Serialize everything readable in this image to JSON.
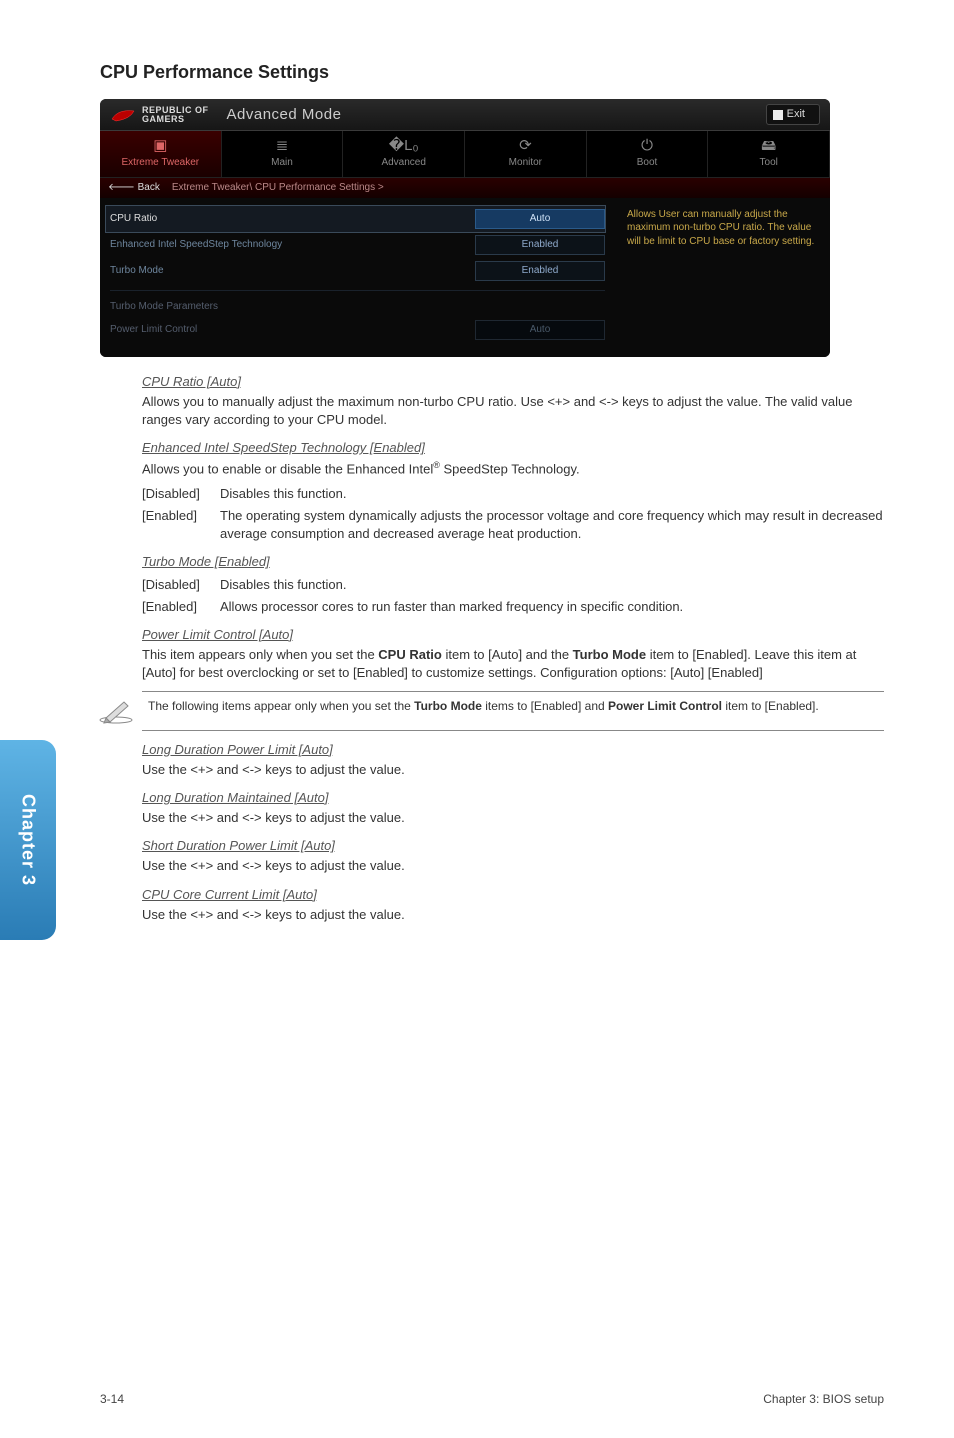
{
  "page": {
    "title": "CPU Performance Settings",
    "side_tab": "Chapter 3",
    "footer_left": "3-14",
    "footer_right": "Chapter 3: BIOS setup"
  },
  "bios": {
    "logo_top": "REPUBLIC OF",
    "logo_bottom": "GAMERS",
    "mode": "Advanced Mode",
    "exit": "Exit",
    "tabs": [
      {
        "icon": "chip-icon",
        "glyph": "▣",
        "label": "Extreme Tweaker",
        "active": true
      },
      {
        "icon": "list-icon",
        "glyph": "≣",
        "label": "Main",
        "active": false
      },
      {
        "icon": "advanced-icon",
        "glyph": "�L₀",
        "label": "Advanced",
        "active": false
      },
      {
        "icon": "monitor-icon",
        "glyph": "⟳",
        "label": "Monitor",
        "active": false
      },
      {
        "icon": "boot-icon",
        "glyph": "⏻",
        "label": "Boot",
        "active": false
      },
      {
        "icon": "tool-icon",
        "glyph": "🖴",
        "label": "Tool",
        "active": false
      }
    ],
    "back_label": "Back",
    "breadcrumb": "Extreme Tweaker\\ CPU Performance Settings >",
    "rows": [
      {
        "label": "CPU Ratio",
        "value": "Auto",
        "selected": true
      },
      {
        "label": "Enhanced Intel SpeedStep Technology",
        "value": "Enabled",
        "selected": false
      },
      {
        "label": "Turbo Mode",
        "value": "Enabled",
        "selected": false
      }
    ],
    "section_label": "Turbo Mode Parameters",
    "section_rows": [
      {
        "label": "Power Limit Control",
        "value": "Auto"
      }
    ],
    "help_text": "Allows User can manually adjust the maximum non-turbo CPU ratio. The value will be limit to CPU base or factory setting."
  },
  "sections": {
    "cpu_ratio": {
      "heading": "CPU Ratio [Auto]",
      "desc": "Allows you to manually adjust the maximum non-turbo CPU ratio. Use <+> and <-> keys to adjust the value. The valid value ranges vary according to your CPU model."
    },
    "eist": {
      "heading": "Enhanced Intel SpeedStep Technology [Enabled]",
      "desc_pre": "Allows you to enable or disable the Enhanced Intel",
      "desc_post": " SpeedStep Technology.",
      "options": [
        {
          "key": "[Disabled]",
          "val": "Disables this function."
        },
        {
          "key": "[Enabled]",
          "val": "The operating system dynamically adjusts the processor voltage and core frequency which may result in decreased average consumption and decreased average heat production."
        }
      ]
    },
    "turbo": {
      "heading": "Turbo Mode [Enabled]",
      "options": [
        {
          "key": "[Disabled]",
          "val": "Disables this function."
        },
        {
          "key": "[Enabled]",
          "val": "Allows processor cores to run faster than marked frequency in specific condition."
        }
      ]
    },
    "plc": {
      "heading": "Power Limit Control [Auto]",
      "desc_parts": [
        "This item appears only when you set the ",
        "CPU Ratio",
        " item to [Auto] and the ",
        "Turbo Mode",
        " item to [Enabled]. Leave this item at [Auto] for best overclocking or set to [Enabled] to customize settings. Configuration options: [Auto] [Enabled]"
      ]
    },
    "note": {
      "parts": [
        "The following items appear only when you set the ",
        "Turbo Mode",
        " items to [Enabled] and ",
        "Power Limit Control",
        " item to [Enabled]."
      ]
    },
    "ldpl": {
      "heading": "Long Duration Power Limit [Auto]",
      "desc": "Use the <+> and <-> keys to adjust the value."
    },
    "ldm": {
      "heading": "Long Duration Maintained [Auto]",
      "desc": "Use the <+> and <-> keys to adjust the value."
    },
    "sdpl": {
      "heading": "Short Duration Power Limit [Auto]",
      "desc": "Use the <+> and <-> keys to adjust the value."
    },
    "cccl": {
      "heading": "CPU Core Current Limit [Auto]",
      "desc": "Use the <+> and <-> keys to adjust the value."
    }
  }
}
